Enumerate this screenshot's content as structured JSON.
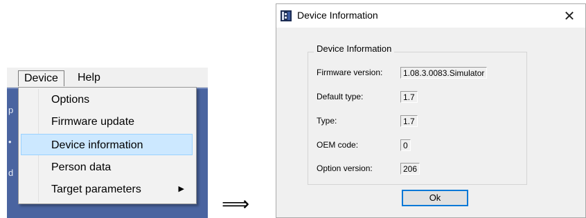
{
  "menu": {
    "bar": {
      "device": "Device",
      "help": "Help"
    },
    "items": [
      {
        "label": "Options"
      },
      {
        "label": "Firmware update"
      },
      {
        "label": "Device information"
      },
      {
        "label": "Person data"
      },
      {
        "label": "Target parameters"
      }
    ],
    "selected": "Device information",
    "background_glyphs": [
      "p",
      "•",
      "d"
    ]
  },
  "arrow": "⟹",
  "dialog": {
    "title": "Device Information",
    "close_glyph": "✕",
    "group_title": "Device Information",
    "fields": [
      {
        "label": "Firmware version:",
        "value": "1.08.3.0083.Simulator"
      },
      {
        "label": "Default type:",
        "value": "1.7"
      },
      {
        "label": "Type:",
        "value": "1.7"
      },
      {
        "label": "OEM code:",
        "value": "0"
      },
      {
        "label": "Option version:",
        "value": "206"
      }
    ],
    "ok_label": "Ok"
  },
  "colors": {
    "menu_highlight": "#cce8ff",
    "app_background": "#4a64a0",
    "default_button_border": "#0078d7"
  }
}
